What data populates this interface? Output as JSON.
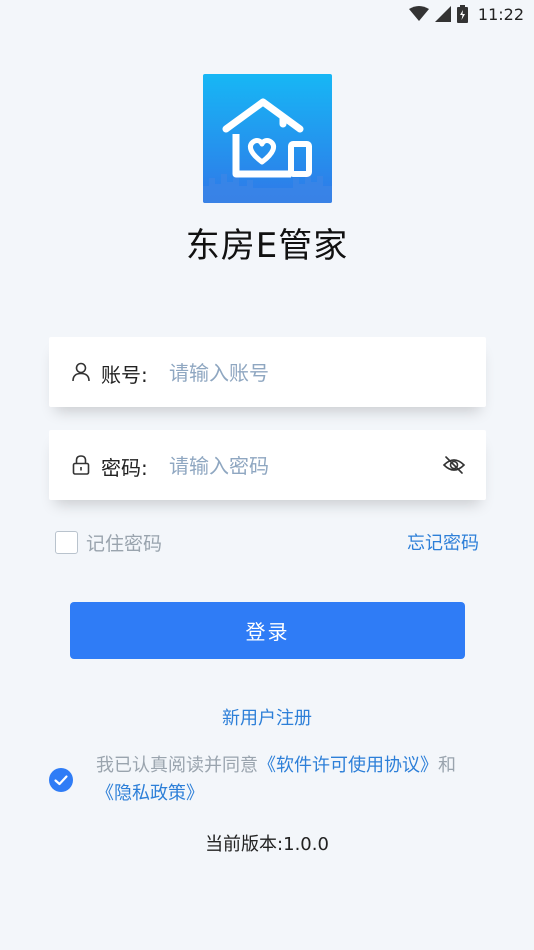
{
  "status_bar": {
    "time": "11:22",
    "icons": [
      "wifi-icon",
      "cellular-signal-icon",
      "battery-charging-icon"
    ]
  },
  "app": {
    "logo_icon": "house-heart-logo-icon",
    "name": "东房E管家"
  },
  "form": {
    "account": {
      "icon": "user-icon",
      "label": "账号:",
      "placeholder": "请输入账号",
      "value": ""
    },
    "password": {
      "icon": "lock-icon",
      "label": "密码:",
      "placeholder": "请输入密码",
      "value": "",
      "toggle_icon": "eye-hidden-icon"
    },
    "remember_label": "记住密码",
    "remember_checked": false,
    "forgot_label": "忘记密码",
    "login_label": "登录",
    "register_label": "新用户注册"
  },
  "agreement": {
    "checked": true,
    "prefix": "我已认真阅读并同意",
    "license_link": "《软件许可使用协议》",
    "conjunction": "和",
    "privacy_link": "《隐私政策》"
  },
  "version_text": "当前版本:1.0.0",
  "colors": {
    "accent": "#2f7cf6",
    "link": "#2d7fd8",
    "background": "#f3f6fa",
    "placeholder": "#8fa7c1"
  }
}
